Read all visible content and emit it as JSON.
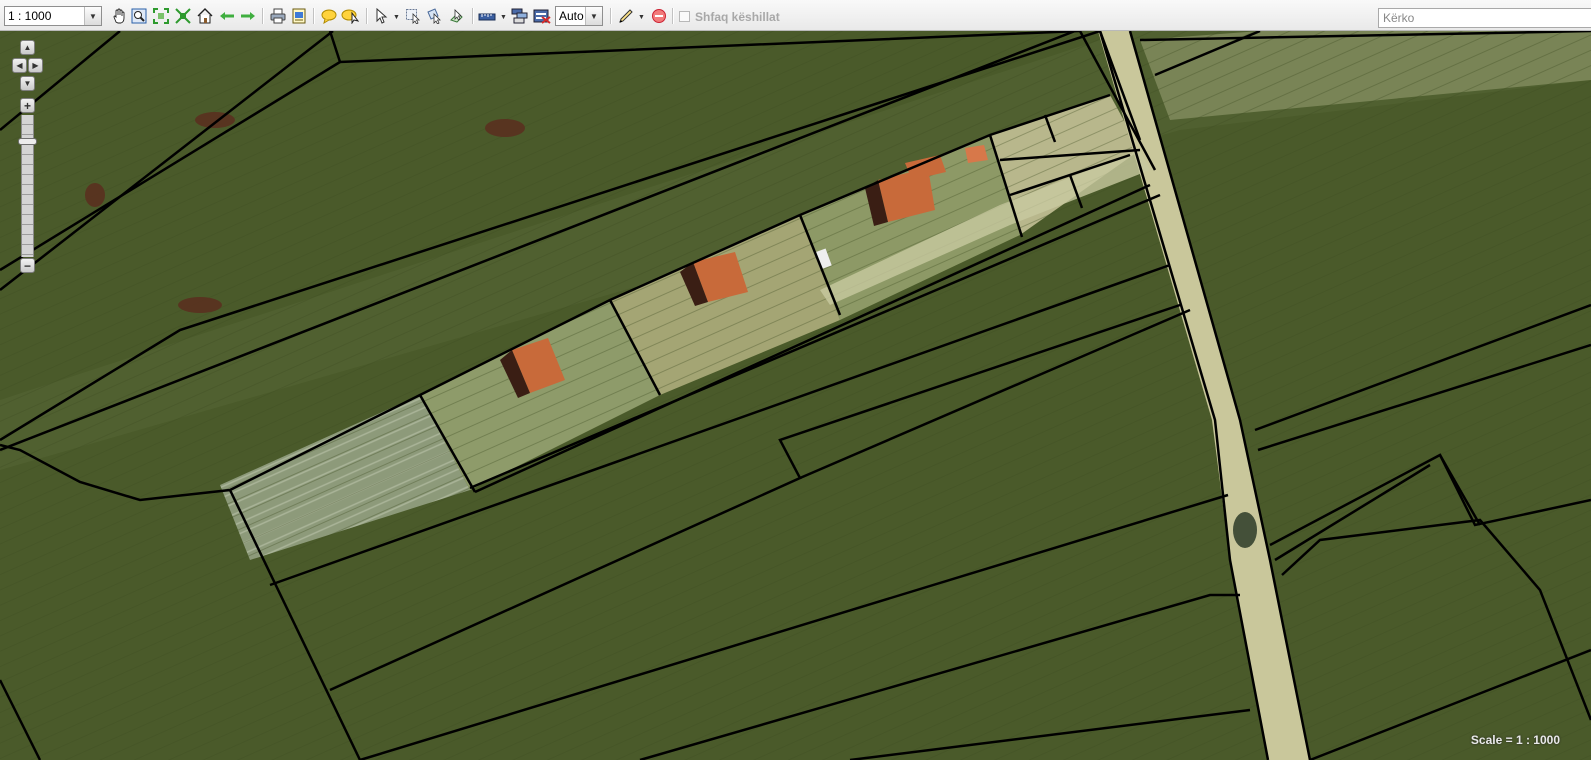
{
  "toolbar": {
    "scale_select": {
      "value": "1 : 1000"
    },
    "auto_select": {
      "value": "Auto"
    },
    "tooltips_checkbox": {
      "label": "Shfaq këshillat",
      "checked": false
    },
    "search": {
      "placeholder": "Kërko",
      "value": ""
    }
  },
  "map": {
    "scale_text": "Scale = 1 : 1000",
    "zoom_level": 0.15,
    "colors": {
      "field": "#4a5a2a",
      "road": "#c9c79b",
      "roof": "#c86a3a",
      "parcel_line": "#000000"
    }
  }
}
